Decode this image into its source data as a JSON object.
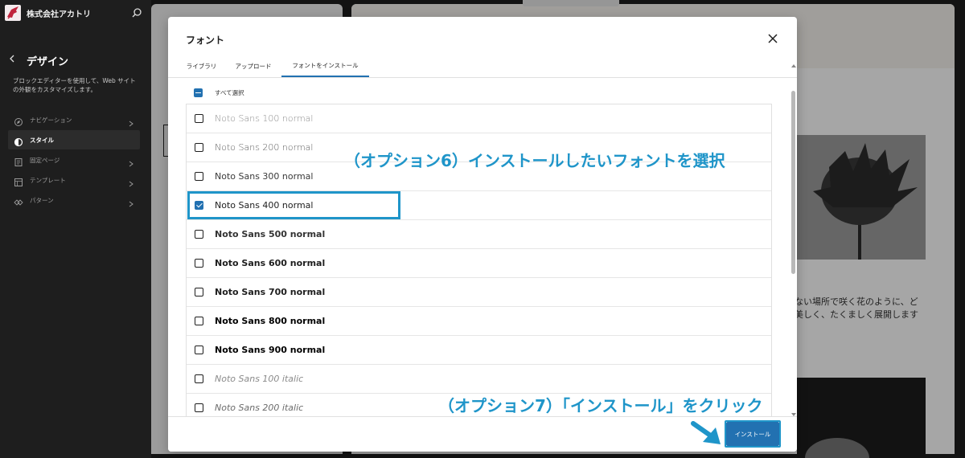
{
  "sidebar": {
    "site_name": "株式会社アカトリ",
    "design_title": "デザイン",
    "design_desc": "ブロックエディターを使用して、Web サイトの外観をカスタマイズします。",
    "items": [
      {
        "label": "ナビゲーション",
        "icon": "navigation-icon",
        "active": false
      },
      {
        "label": "スタイル",
        "icon": "styles-icon",
        "active": true
      },
      {
        "label": "固定ページ",
        "icon": "page-icon",
        "active": false
      },
      {
        "label": "テンプレート",
        "icon": "template-icon",
        "active": false
      },
      {
        "label": "パターン",
        "icon": "pattern-icon",
        "active": false
      }
    ]
  },
  "background": {
    "text_line1": "ない場所で咲く花のように、ど",
    "text_line2": "美しく、たくましく展開します"
  },
  "modal": {
    "title": "フォント",
    "tabs": [
      {
        "label": "ライブラリ",
        "active": false
      },
      {
        "label": "アップロード",
        "active": false
      },
      {
        "label": "フォントをインストール",
        "active": true
      }
    ],
    "select_all": "すべて選択",
    "fonts": [
      {
        "name": "Noto Sans 100 normal",
        "weight": 100,
        "style": "normal",
        "checked": false
      },
      {
        "name": "Noto Sans 200 normal",
        "weight": 200,
        "style": "normal",
        "checked": false
      },
      {
        "name": "Noto Sans 300 normal",
        "weight": 300,
        "style": "normal",
        "checked": false
      },
      {
        "name": "Noto Sans 400 normal",
        "weight": 400,
        "style": "normal",
        "checked": true
      },
      {
        "name": "Noto Sans 500 normal",
        "weight": 500,
        "style": "normal",
        "checked": false
      },
      {
        "name": "Noto Sans 600 normal",
        "weight": 600,
        "style": "normal",
        "checked": false
      },
      {
        "name": "Noto Sans 700 normal",
        "weight": 700,
        "style": "normal",
        "checked": false
      },
      {
        "name": "Noto Sans 800 normal",
        "weight": 800,
        "style": "normal",
        "checked": false
      },
      {
        "name": "Noto Sans 900 normal",
        "weight": 900,
        "style": "normal",
        "checked": false
      },
      {
        "name": "Noto Sans 100 italic",
        "weight": 100,
        "style": "italic",
        "checked": false
      },
      {
        "name": "Noto Sans 200 italic",
        "weight": 200,
        "style": "italic",
        "checked": false
      }
    ],
    "install_label": "インストール"
  },
  "annotations": {
    "callout_6": "（オプション6）インストールしたいフォントを選択",
    "callout_7": "（オプション7）「インストール」をクリック",
    "color": "#1f95c9"
  },
  "colors": {
    "accent": "#2271b1",
    "sidebar_bg": "#1e1e1e"
  }
}
